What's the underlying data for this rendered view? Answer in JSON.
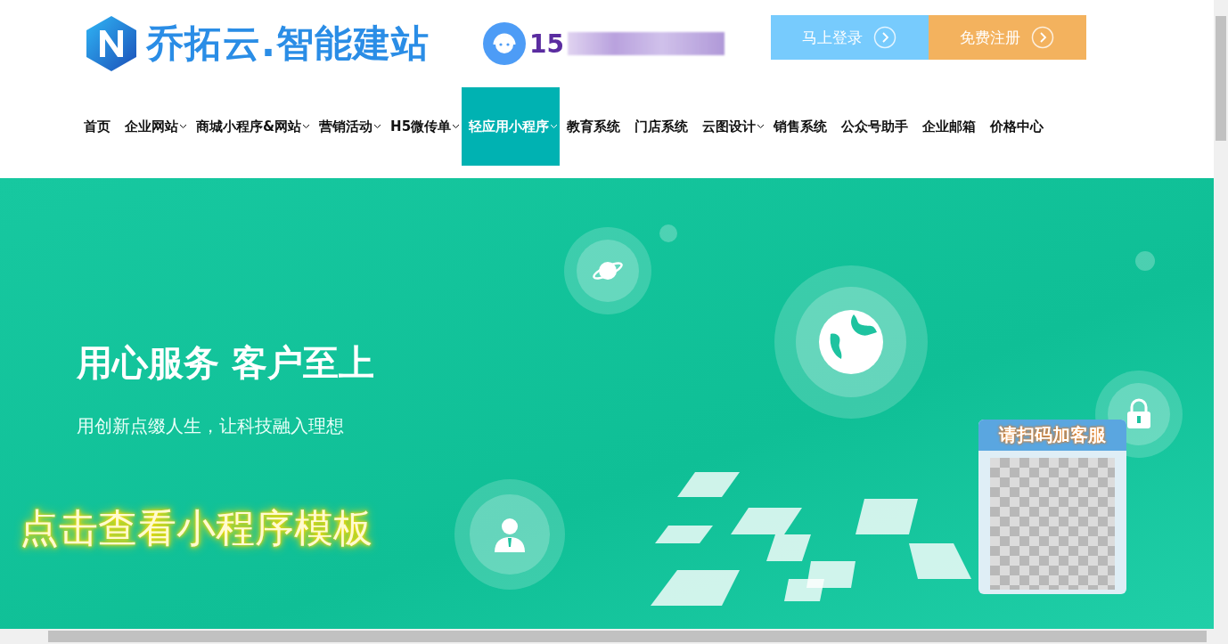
{
  "header": {
    "logo_text": "乔拓云.智能建站",
    "phone_prefix": "15",
    "buttons": [
      {
        "label": "马上登录",
        "kind": "login"
      },
      {
        "label": "免费注册",
        "kind": "register"
      }
    ]
  },
  "nav": [
    {
      "label": "首页",
      "dropdown": false,
      "selected": false
    },
    {
      "label": "企业网站",
      "dropdown": true,
      "selected": false
    },
    {
      "label": "商城小程序&网站",
      "dropdown": true,
      "selected": false
    },
    {
      "label": "营销活动",
      "dropdown": true,
      "selected": false
    },
    {
      "label": "H5微传单",
      "dropdown": true,
      "selected": false
    },
    {
      "label": "轻应用小程序",
      "dropdown": true,
      "selected": true
    },
    {
      "label": "教育系统",
      "dropdown": false,
      "selected": false
    },
    {
      "label": "门店系统",
      "dropdown": false,
      "selected": false
    },
    {
      "label": "云图设计",
      "dropdown": true,
      "selected": false
    },
    {
      "label": "销售系统",
      "dropdown": false,
      "selected": false
    },
    {
      "label": "公众号助手",
      "dropdown": false,
      "selected": false
    },
    {
      "label": "企业邮箱",
      "dropdown": false,
      "selected": false
    },
    {
      "label": "价格中心",
      "dropdown": false,
      "selected": false
    }
  ],
  "banner": {
    "heading": "用心服务 客户至上",
    "subheading": "用创新点缀人生，让科技融入理想",
    "template_link": "点击查看小程序模板",
    "qr_title": "请扫码加客服"
  }
}
